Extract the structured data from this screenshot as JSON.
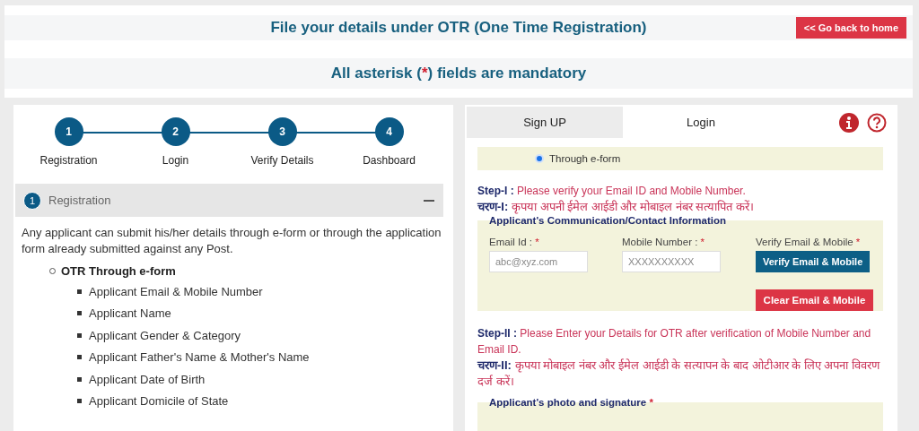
{
  "header": {
    "title": "File your details under OTR (One Time Registration)",
    "home_button": "<< Go back to home"
  },
  "notice": {
    "text_before": "All asterisk (",
    "mark": "*",
    "text_after": ") fields are mandatory"
  },
  "stepper": [
    {
      "number": "1",
      "label": "Registration"
    },
    {
      "number": "2",
      "label": "Login"
    },
    {
      "number": "3",
      "label": "Verify Details"
    },
    {
      "number": "4",
      "label": "Dashboard"
    }
  ],
  "accordion": {
    "number": "1",
    "title": "Registration",
    "expanded": true,
    "intro": "Any applicant can submit his/her details through e-form or through the application form already submitted against any Post.",
    "list_title": "OTR Through e-form",
    "items": [
      "Applicant Email & Mobile Number",
      "Applicant Name",
      "Applicant Gender & Category",
      "Applicant Father's Name & Mother's Name",
      "Applicant Date of Birth",
      "Applicant Domicile of State"
    ]
  },
  "tabs": [
    {
      "label": "Sign UP",
      "selected": true
    },
    {
      "label": "Login",
      "selected": false
    }
  ],
  "mode_options": [
    {
      "label": "Through e-form",
      "selected": true
    }
  ],
  "step_1": {
    "label": "Step-I :",
    "text": "Please verify your Email ID and Mobile Number.",
    "hindi_label": "चरण-I:",
    "hindi_text": "कृपया अपनी ईमेल आईडी और मोबाइल नंबर सत्यापित करें।"
  },
  "contact_section": {
    "legend": "Applicant's Communication/Contact Information",
    "fields": [
      {
        "label": "Email Id :",
        "mark": "*",
        "placeholder": "abc@xyz.com"
      },
      {
        "label": "Mobile Number :",
        "mark": "*",
        "placeholder": "XXXXXXXXXX"
      }
    ],
    "verify_label": "Verify Email & Mobile",
    "verify_mark": "*",
    "verify_button": "Verify Email & Mobile",
    "clear_button": "Clear Email & Mobile"
  },
  "step_2": {
    "label": "Step-II :",
    "text": "Please Enter your Details for OTR after verification of Mobile Number and Email ID.",
    "hindi_label": "चरण-II:",
    "hindi_text": "कृपया मोबाइल नंबर और ईमेल आईडी के सत्यापन के बाद ओटीआर के लिए अपना विवरण दर्ज करें।"
  },
  "photo_section": {
    "legend": "Applicant's photo and signature",
    "mark": "*"
  }
}
